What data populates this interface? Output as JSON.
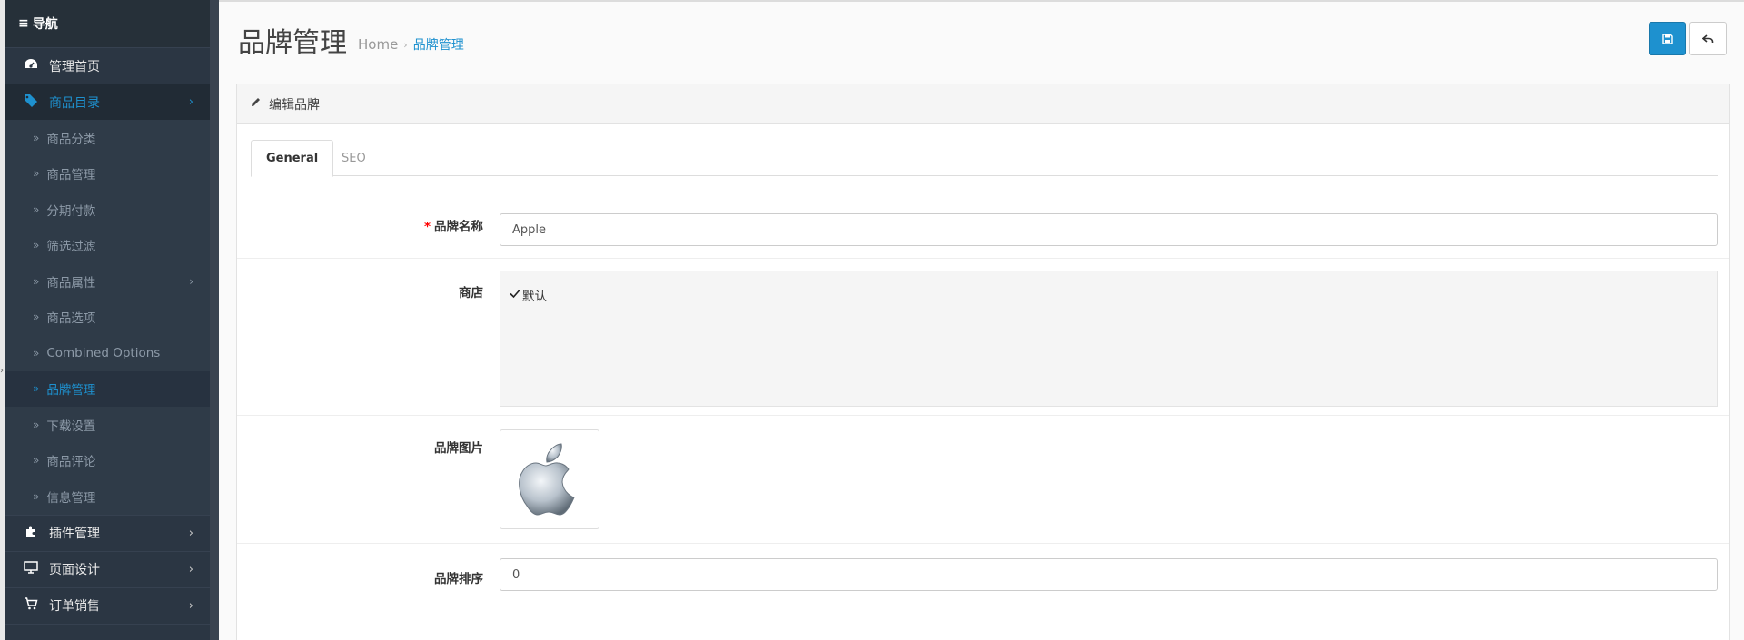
{
  "sidebar": {
    "header": "导航",
    "items": [
      {
        "label": "管理首页",
        "icon": "dashboard-icon",
        "expandable": false
      },
      {
        "label": "商品目录",
        "icon": "tags-icon",
        "expandable": true,
        "active": true
      }
    ],
    "catalog_sub": [
      {
        "label": "商品分类"
      },
      {
        "label": "商品管理"
      },
      {
        "label": "分期付款"
      },
      {
        "label": "筛选过滤"
      },
      {
        "label": "商品属性",
        "expandable": true
      },
      {
        "label": "商品选项"
      },
      {
        "label": "Combined Options"
      },
      {
        "label": "品牌管理",
        "current": true
      },
      {
        "label": "下载设置"
      },
      {
        "label": "商品评论"
      },
      {
        "label": "信息管理"
      }
    ],
    "bottom_items": [
      {
        "label": "插件管理",
        "icon": "puzzle-icon"
      },
      {
        "label": "页面设计",
        "icon": "desktop-icon"
      },
      {
        "label": "订单销售",
        "icon": "cart-icon"
      }
    ]
  },
  "header": {
    "title": "品牌管理",
    "breadcrumb": [
      "Home",
      "品牌管理"
    ]
  },
  "panel": {
    "heading": "编辑品牌",
    "tabs": [
      "General",
      "SEO"
    ]
  },
  "form": {
    "name_label": "品牌名称",
    "name_value": "Apple",
    "store_label": "商店",
    "store_option": "默认",
    "image_label": "品牌图片",
    "sort_label": "品牌排序",
    "sort_value": "0"
  },
  "colors": {
    "accent": "#1e91cf",
    "sidebar_bg": "#2b3643",
    "required": "#ff0000"
  }
}
